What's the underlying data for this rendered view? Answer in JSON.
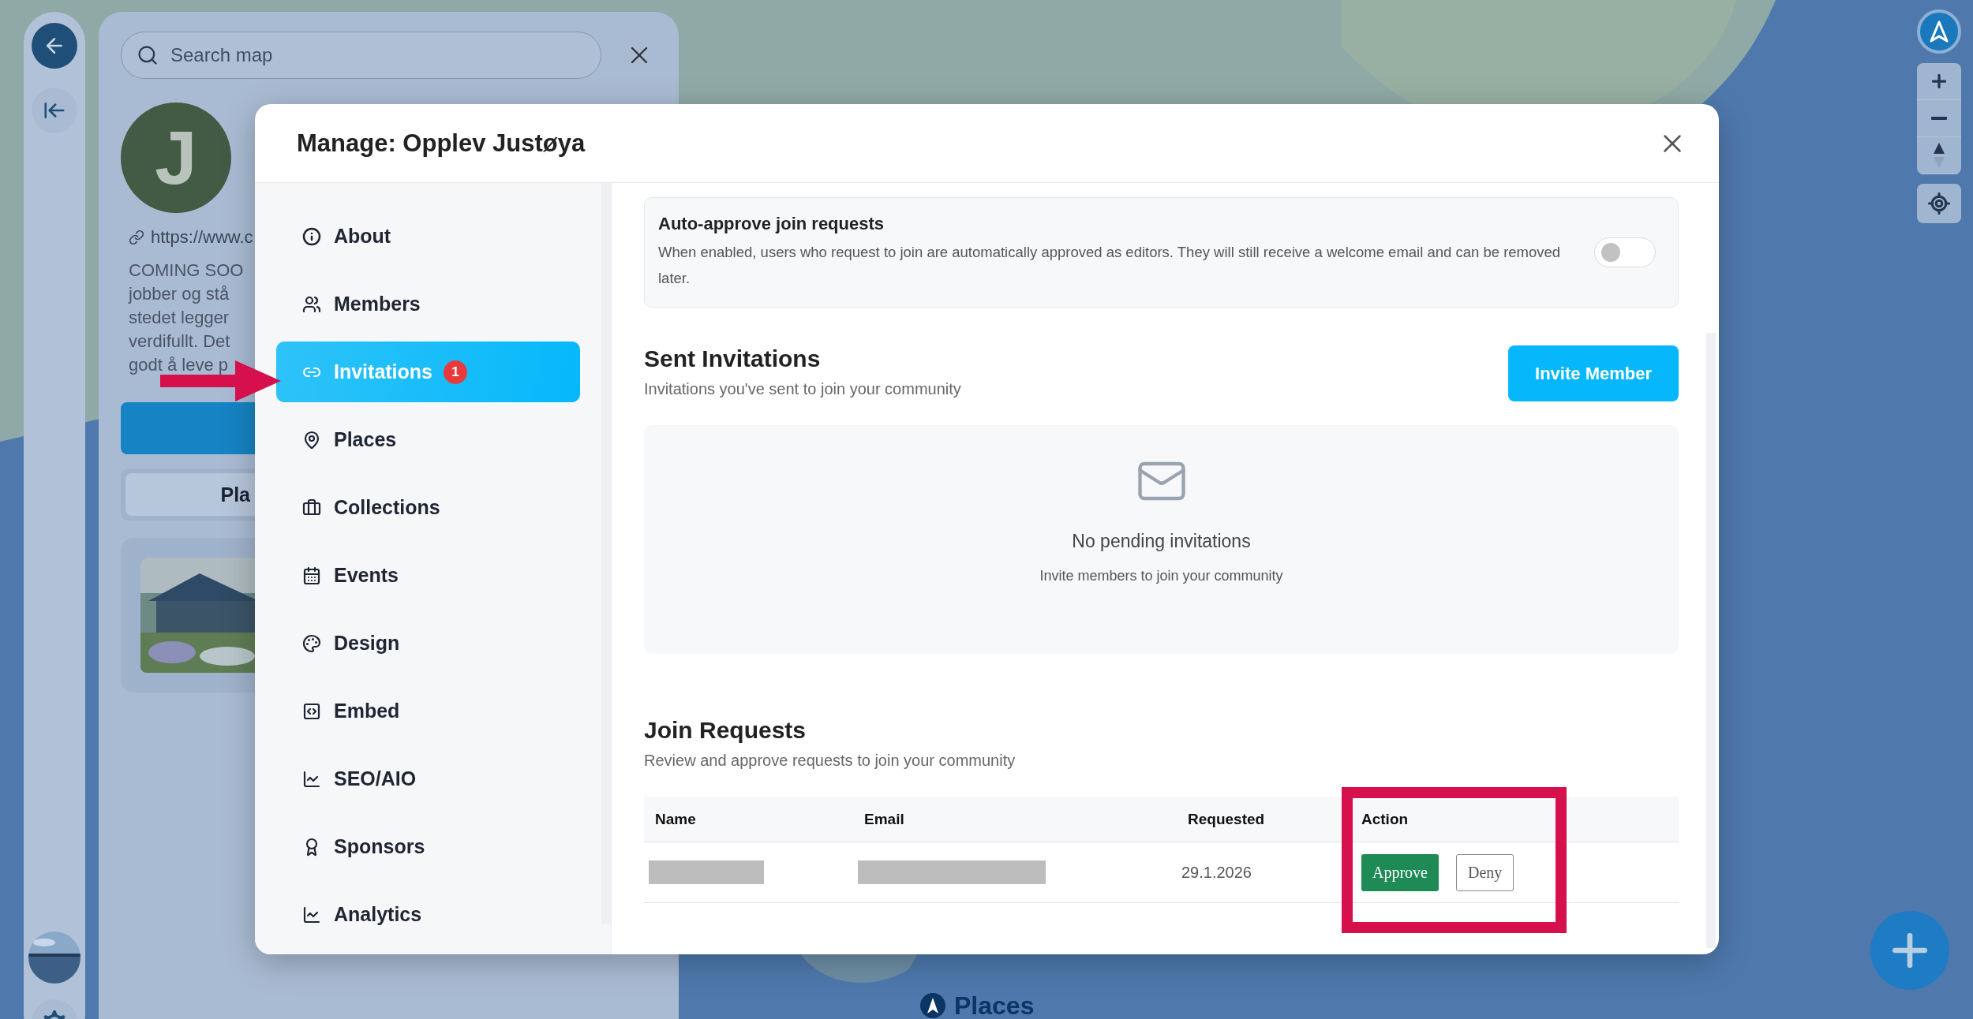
{
  "left_panel": {
    "search": {
      "placeholder": "Search map"
    },
    "avatar_letter": "J",
    "link": "https://www.c",
    "description_lines": [
      "COMING SOO",
      "jobber og stå",
      "stedet legger",
      "verdifullt. Det",
      "godt å leve p"
    ],
    "tab_button": "Pla"
  },
  "map": {
    "places_label": "Places"
  },
  "modal": {
    "title": "Manage: Opplev Justøya",
    "nav": [
      {
        "label": "About",
        "selected": false
      },
      {
        "label": "Members",
        "selected": false
      },
      {
        "label": "Invitations",
        "selected": true,
        "badge": "1"
      },
      {
        "label": "Places",
        "selected": false
      },
      {
        "label": "Collections",
        "selected": false
      },
      {
        "label": "Events",
        "selected": false
      },
      {
        "label": "Design",
        "selected": false
      },
      {
        "label": "Embed",
        "selected": false
      },
      {
        "label": "SEO/AIO",
        "selected": false
      },
      {
        "label": "Sponsors",
        "selected": false
      },
      {
        "label": "Analytics",
        "selected": false
      }
    ],
    "auto_approve": {
      "title": "Auto-approve join requests",
      "description": "When enabled, users who request to join are automatically approved as editors. They will still receive a welcome email and can be removed later.",
      "on": false
    },
    "sent_invitations": {
      "title": "Sent Invitations",
      "subtitle": "Invitations you've sent to join your community",
      "button": "Invite Member",
      "empty_title": "No pending invitations",
      "empty_subtitle": "Invite members to join your community"
    },
    "join_requests": {
      "title": "Join Requests",
      "subtitle": "Review and approve requests to join your community",
      "columns": [
        "Name",
        "Email",
        "Requested",
        "Action"
      ],
      "rows": [
        {
          "name_redacted": true,
          "email_redacted": true,
          "requested": "29.1.2026",
          "approve": "Approve",
          "deny": "Deny"
        }
      ]
    }
  }
}
